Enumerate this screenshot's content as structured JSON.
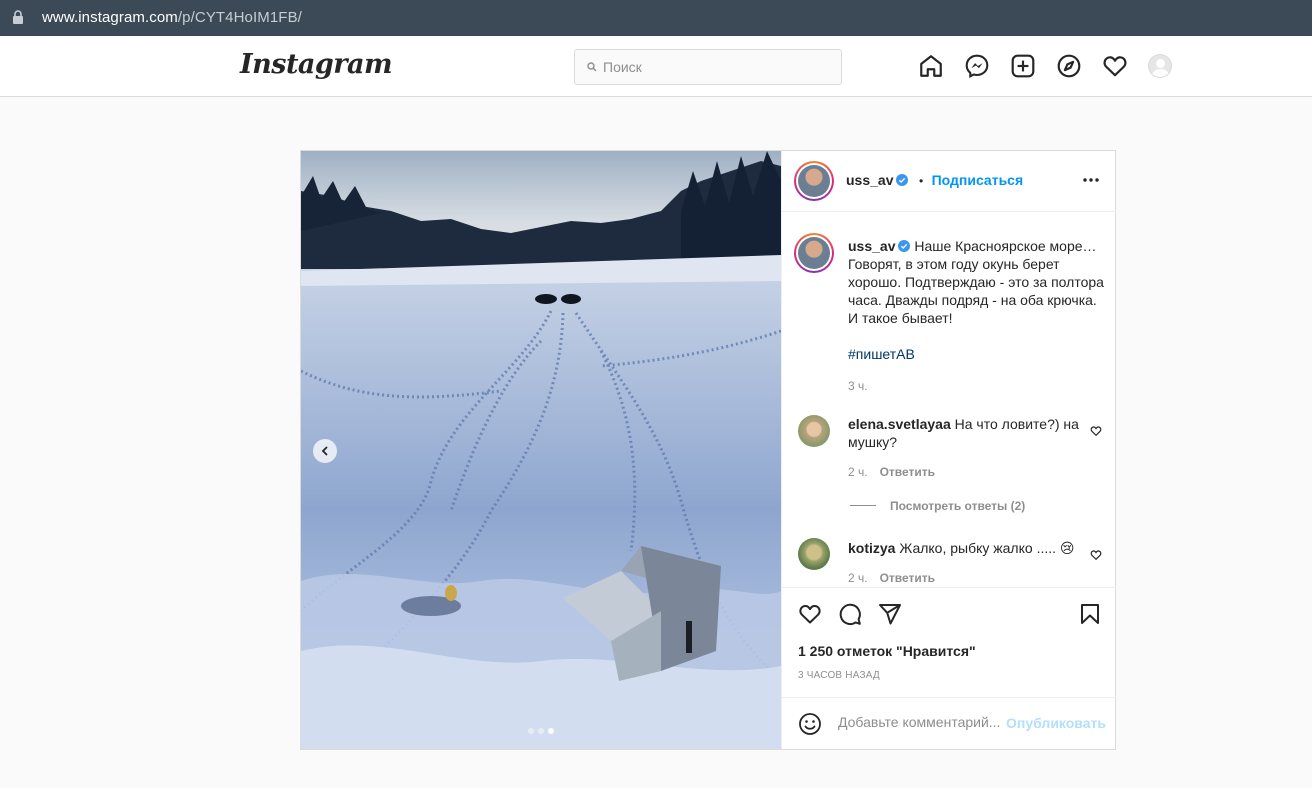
{
  "browser": {
    "url_host": "www.instagram.com",
    "url_path": "/p/CYT4HoIM1FB/"
  },
  "header": {
    "logo": "Instagram",
    "search_placeholder": "Поиск",
    "nav_icons": [
      "home-icon",
      "messenger-icon",
      "new-post-icon",
      "explore-icon",
      "activity-heart-icon",
      "profile-avatar"
    ]
  },
  "post": {
    "author": "uss_av",
    "follow_label": "Подписаться",
    "separator": "•",
    "caption": "Наше Красноярское море… Говорят, в этом году окунь берет хорошо. Подтверждаю - это за полтора часа. Дважды подряд - на оба крючка. И такое бывает!",
    "hashtag": "#пишетАВ",
    "caption_age": "3 ч.",
    "carousel": {
      "count": 3,
      "active_index": 2
    },
    "comments": [
      {
        "user": "elena.svetlayaa",
        "text": "На что ловите?) на мушку?",
        "age": "2 ч.",
        "reply_label": "Ответить"
      },
      {
        "user": "kotizya",
        "text": "Жалко, рыбку жалко ..... 😢",
        "age": "2 ч.",
        "reply_label": "Ответить"
      }
    ],
    "view_replies": "Посмотреть ответы (2)",
    "likes": "1 250 отметок \"Нравится\"",
    "posted_ago": "3 ЧАСОВ НАЗАД",
    "add_comment_placeholder": "Добавьте комментарий...",
    "publish_label": "Опубликовать"
  },
  "colors": {
    "accent": "#0095f6",
    "publish_disabled": "#b2dffc",
    "hashtag": "#00376b",
    "browser_bar": "#3c4a57"
  }
}
